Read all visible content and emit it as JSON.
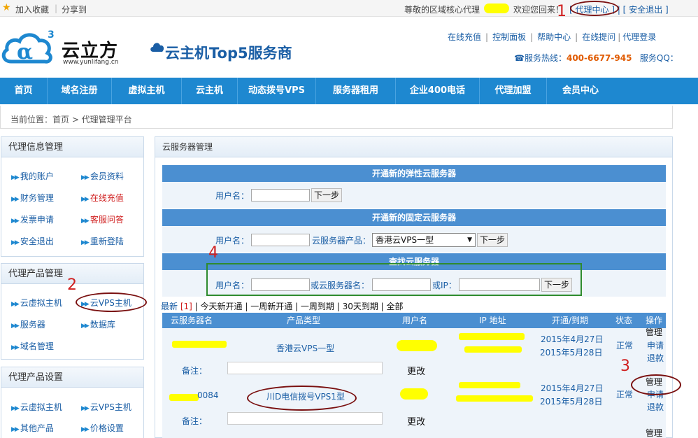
{
  "topbar": {
    "favorite": "加入收藏",
    "share": "分享到",
    "greeting": "尊敬的区域核心代理",
    "welcome": "欢迎您回来！",
    "agent_center": "代理中心",
    "logout": "安全退出"
  },
  "header": {
    "brand_name": "云立方",
    "brand_url": "www.yunlifang.cn",
    "slogan": "云主机Top5服务商",
    "top_links": [
      "在线充值",
      "控制面板",
      "帮助中心",
      "在线提问",
      "代理登录"
    ],
    "hotline_label": "服务热线：",
    "hotline_number": "400-6677-945",
    "qq_label": "服务QQ："
  },
  "nav": [
    "首页",
    "域名注册",
    "虚拟主机",
    "云主机",
    "动态拨号VPS",
    "服务器租用",
    "企业400电话",
    "代理加盟",
    "会员中心"
  ],
  "breadcrumb": "当前位置：首页 > 代理管理平台",
  "sidebar": {
    "info": {
      "title": "代理信息管理",
      "items": [
        "我的账户",
        "会员资料",
        "财务管理",
        "在线充值",
        "发票申请",
        "客服问答",
        "安全退出",
        "重新登陆"
      ]
    },
    "products": {
      "title": "代理产品管理",
      "items": [
        "云虚拟主机",
        "云VPS主机",
        "服务器",
        "数据库",
        "域名管理"
      ]
    },
    "settings": {
      "title": "代理产品设置",
      "items": [
        "云虚拟主机",
        "云VPS主机",
        "其他产品",
        "价格设置"
      ]
    }
  },
  "main": {
    "title": "云服务器管理",
    "elastic": {
      "title": "开通新的弹性云服务器",
      "username_label": "用户名：",
      "next": "下一步"
    },
    "fixed": {
      "title": "开通新的固定云服务器",
      "username_label": "用户名：",
      "product_label": "云服务器产品：",
      "product_selected": "香港云VPS一型",
      "next": "下一步"
    },
    "search": {
      "title": "查找云服务器",
      "username_label": "用户名：",
      "server_label": "或云服务器名：",
      "ip_label": "或IP：",
      "next": "下一步"
    },
    "filters": {
      "latest": "最新",
      "count": "[1]",
      "options": [
        "今天新开通",
        "一周新开通",
        "一周到期",
        "30天到期",
        "全部"
      ]
    },
    "table": {
      "headers": [
        "云服务器名",
        "产品类型",
        "用户名",
        "IP 地址",
        "开通/到期",
        "状态",
        "操作"
      ],
      "rows": [
        {
          "product": "香港云VPS一型",
          "open": "2015年4月27日",
          "expire": "2015年5月28日",
          "status": "正常",
          "actions": [
            "管理",
            "申请",
            "退款"
          ],
          "note_label": "备注：",
          "update": "更改"
        },
        {
          "name": "0084",
          "product": "川D电信拨号VPS1型",
          "open": "2015年4月27日",
          "expire": "2015年5月28日",
          "status": "正常",
          "actions": [
            "管理",
            "申请",
            "退款"
          ],
          "note_label": "备注：",
          "update": "更改"
        }
      ],
      "next_action": "管理"
    }
  },
  "annotations": [
    "1",
    "2",
    "3",
    "4"
  ]
}
